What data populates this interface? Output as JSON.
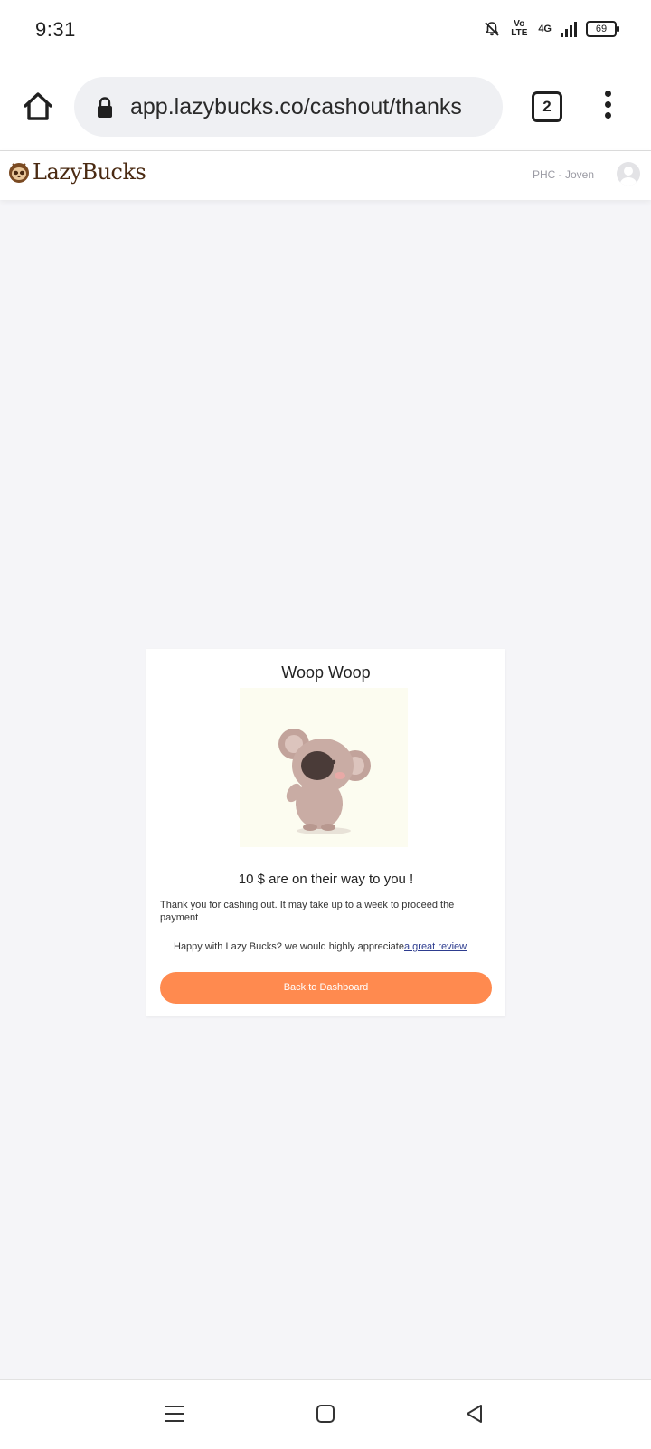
{
  "status_bar": {
    "time": "9:31",
    "volte_label": "Vo LTE",
    "network": "4G",
    "battery": "69"
  },
  "browser": {
    "url": "app.lazybucks.co/cashout/thanks",
    "tab_count": "2"
  },
  "site_header": {
    "logo_text": "LazyBucks",
    "user_name": "PHC - Joven"
  },
  "card": {
    "title": "Woop Woop",
    "amount_message": "10 $ are on their way to you !",
    "thanks_message": "Thank you for cashing out. It may take up to a week to proceed the payment",
    "review_prompt": "Happy with Lazy Bucks? we would highly appreciate",
    "review_link": "a great review",
    "back_button": "Back to Dashboard"
  },
  "colors": {
    "accent": "#ff8a4f",
    "brand": "#4a2a12",
    "background": "#f5f5f8",
    "link": "#2d3c8f"
  },
  "icons": {
    "home": "home-icon",
    "lock": "lock-icon",
    "tabs": "tabs-icon",
    "menu": "more-vert-icon",
    "koala": "koala-illustration",
    "nav_recents": "recents-icon",
    "nav_home": "nav-home-icon",
    "nav_back": "nav-back-icon"
  }
}
